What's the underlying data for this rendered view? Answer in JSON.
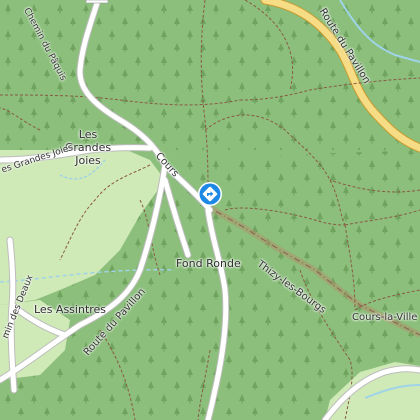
{
  "map": {
    "places": {
      "grandes_joies": "Les Grandes Joies",
      "fond_ronde": "Fond Ronde",
      "assintres": "Les Assintres"
    },
    "roads": {
      "chemin_paquis": "Chemin du Pâquis",
      "route_pavillon_ne": "Route du Pavillon",
      "route_pavillon_sw": "Route du Pavillon",
      "chemin_grandes_joies": "es Grandes Joies",
      "cours": "Cours",
      "thizy": "Thizy-les-Bourgs",
      "cours_la_ville": "Cours-la-Ville",
      "chemin_deaux": "min des Deaux"
    },
    "marker": {
      "icon": "direction-diamond-icon",
      "color": "#1e88e5"
    },
    "colors": {
      "forest": "#8bbf7b",
      "clearing": "#cfe9b7",
      "road": "#ffffff",
      "water": "#9fd3e8",
      "boundary": "#b98b6a",
      "path": "#8a5a44"
    }
  }
}
